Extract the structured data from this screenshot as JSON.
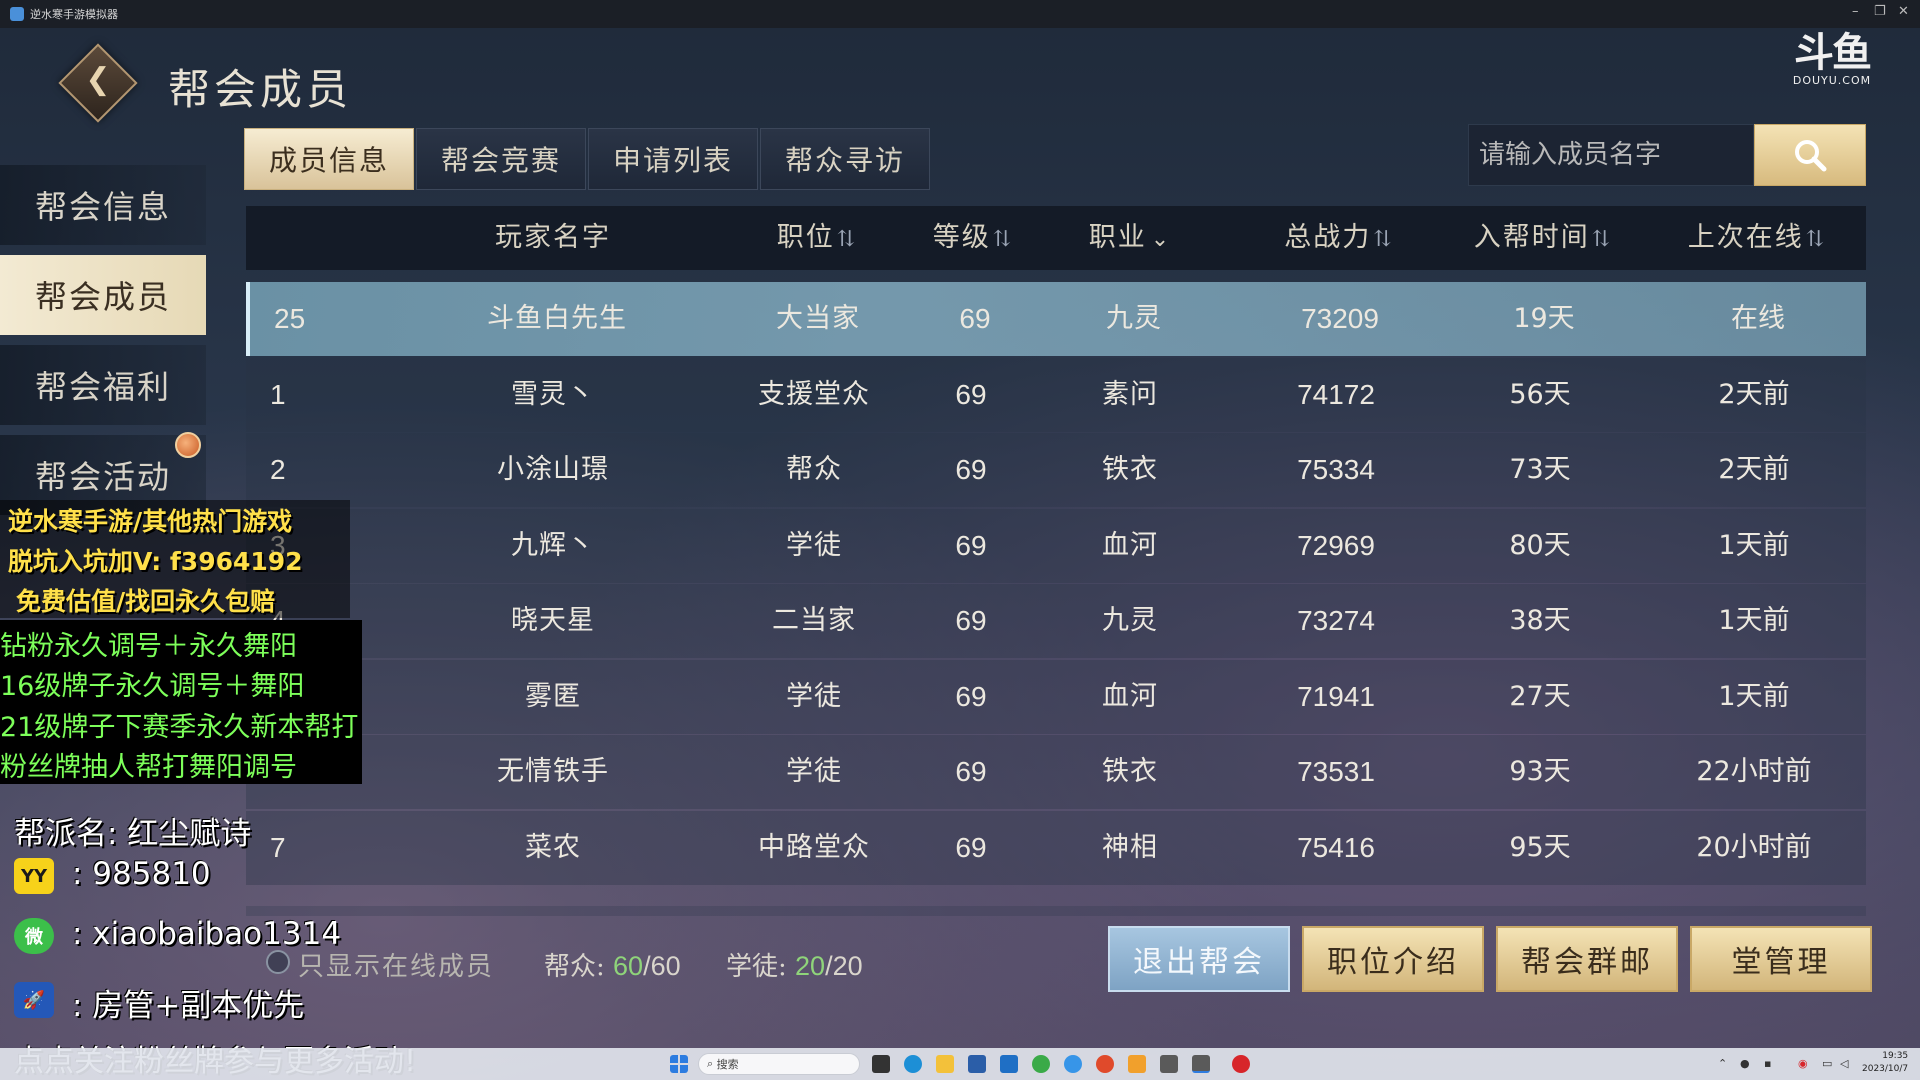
{
  "window": {
    "title": "逆水寒手游模拟器",
    "minimize": "–",
    "restore": "❐",
    "close": "✕"
  },
  "header": {
    "title": "帮会成员",
    "back_glyph": "❮",
    "logo_mark": "斗鱼",
    "logo_sub": "DOUYU.COM"
  },
  "sidebar": {
    "items": [
      {
        "label": "帮会信息",
        "active": false
      },
      {
        "label": "帮会成员",
        "active": true
      },
      {
        "label": "帮会福利",
        "active": false
      },
      {
        "label": "帮会活动",
        "active": false
      }
    ]
  },
  "tabs": [
    {
      "label": "成员信息",
      "active": true
    },
    {
      "label": "帮会竞赛",
      "active": false
    },
    {
      "label": "申请列表",
      "active": false
    },
    {
      "label": "帮众寻访",
      "active": false
    }
  ],
  "search": {
    "placeholder": "请输入成员名字"
  },
  "table": {
    "columns": [
      {
        "label": "玩家名字",
        "icon": ""
      },
      {
        "label": "职位",
        "icon": "⇅"
      },
      {
        "label": "等级",
        "icon": "⇅"
      },
      {
        "label": "职业",
        "icon": "⌄"
      },
      {
        "label": "总战力",
        "icon": "⇅"
      },
      {
        "label": "入帮时间",
        "icon": "⇅"
      },
      {
        "label": "上次在线",
        "icon": "⇅"
      }
    ],
    "rows": [
      {
        "rank": "25",
        "name": "斗鱼白先生",
        "position": "大当家",
        "level": "69",
        "class": "九灵",
        "power": "73209",
        "joined": "19天",
        "last_online": "在线",
        "self": true
      },
      {
        "rank": "1",
        "name": "雪灵丶",
        "position": "支援堂众",
        "level": "69",
        "class": "素问",
        "power": "74172",
        "joined": "56天",
        "last_online": "2天前"
      },
      {
        "rank": "2",
        "name": "小涂山璟",
        "position": "帮众",
        "level": "69",
        "class": "铁衣",
        "power": "75334",
        "joined": "73天",
        "last_online": "2天前"
      },
      {
        "rank": "3",
        "name": "九辉丶",
        "position": "学徒",
        "level": "69",
        "class": "血河",
        "power": "72969",
        "joined": "80天",
        "last_online": "1天前"
      },
      {
        "rank": "4",
        "name": "晓天星",
        "position": "二当家",
        "level": "69",
        "class": "九灵",
        "power": "73274",
        "joined": "38天",
        "last_online": "1天前"
      },
      {
        "rank": "",
        "name": "雾匿",
        "position": "学徒",
        "level": "69",
        "class": "血河",
        "power": "71941",
        "joined": "27天",
        "last_online": "1天前"
      },
      {
        "rank": "",
        "name": "无情铁手",
        "position": "学徒",
        "level": "69",
        "class": "铁衣",
        "power": "73531",
        "joined": "93天",
        "last_online": "22小时前"
      },
      {
        "rank": "7",
        "name": "菜农",
        "position": "中路堂众",
        "level": "69",
        "class": "神相",
        "power": "75416",
        "joined": "95天",
        "last_online": "20小时前"
      }
    ]
  },
  "footer": {
    "online_only_label": "只显示在线成员",
    "members_label": "帮众:",
    "members_current": "60",
    "members_max": "/60",
    "apprentices_label": "学徒:",
    "apprentices_current": "20",
    "apprentices_max": "/20",
    "buttons": [
      {
        "label": "退出帮会",
        "style": "blue"
      },
      {
        "label": "职位介绍",
        "style": "gold"
      },
      {
        "label": "帮会群邮",
        "style": "gold"
      },
      {
        "label": "堂管理",
        "style": "gold"
      }
    ]
  },
  "overlay": {
    "ad_yellow": [
      "逆水寒手游/其他热门游戏",
      "脱坑入坑加V: f3964192",
      "免费估值/找回永久包赔"
    ],
    "ad_green": [
      "钻粉永久调号＋永久舞阳",
      "16级牌子永久调号＋舞阳",
      "21级牌子下赛季永久新本帮打",
      "粉丝牌抽人帮打舞阳调号"
    ],
    "guild_name_line": "帮派名: 红尘赋诗",
    "yy_icon": "YY",
    "yy_value": ": 985810",
    "wechat_icon": "微",
    "wechat_value": ": xiaobaibao1314",
    "rocket_icon": "🚀",
    "rocket_value": ": 房管+副本优先",
    "follow_line": "点点关注粉丝牌参与更多活动!"
  },
  "taskbar": {
    "search_placeholder": "搜索",
    "time": "19:35",
    "date": "2023/10/7"
  },
  "colors": {
    "accent_gold": "#d7ba7e",
    "highlight_row": "#7fa8bc",
    "count_green": "#8fd47a"
  }
}
